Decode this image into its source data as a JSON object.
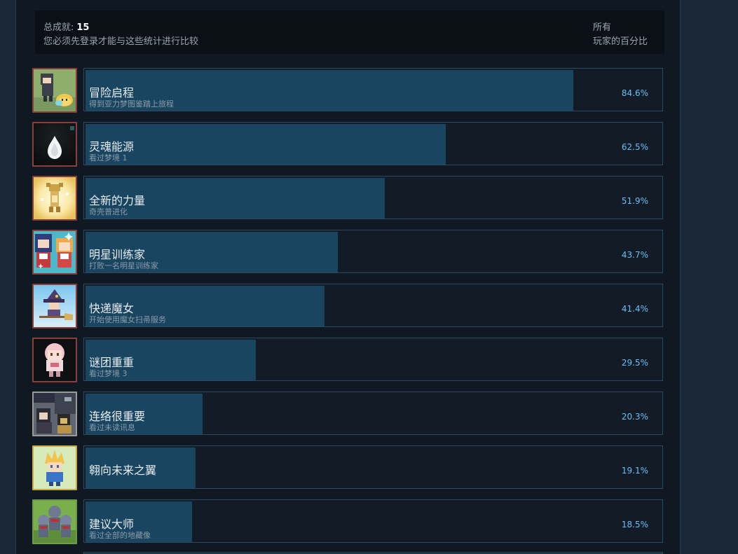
{
  "header": {
    "total_label": "总成就:",
    "total_value": "15",
    "login_note": "您必须先登录才能与这些统计进行比较",
    "all_label": "所有",
    "percent_label": "玩家的百分比"
  },
  "achievements": [
    {
      "name": "冒险启程",
      "desc": "得到亚力梦图鉴踏上旅程",
      "percent": "84.6%",
      "value": 84.6,
      "icon": "hooded-figure-with-slime-icon"
    },
    {
      "name": "灵魂能源",
      "desc": "看过梦境 1",
      "percent": "62.5%",
      "value": 62.5,
      "icon": "soul-flame-icon"
    },
    {
      "name": "全新的力量",
      "desc": "奇壳普进化",
      "percent": "51.9%",
      "value": 51.9,
      "icon": "glowing-creature-icon"
    },
    {
      "name": "明星训练家",
      "desc": "打败一名明星训练家",
      "percent": "43.7%",
      "value": 43.7,
      "icon": "two-trainers-icon"
    },
    {
      "name": "快递魔女",
      "desc": "开始使用魔女扫帚服务",
      "percent": "41.4%",
      "value": 41.4,
      "icon": "witch-on-broom-icon"
    },
    {
      "name": "谜团重重",
      "desc": "看过梦境 3",
      "percent": "29.5%",
      "value": 29.5,
      "icon": "pink-haired-girl-icon"
    },
    {
      "name": "连络很重要",
      "desc": "看过未读讯息",
      "percent": "20.3%",
      "value": 20.3,
      "icon": "message-scene-icon"
    },
    {
      "name": "翱向未来之翼",
      "desc": "",
      "percent": "19.1%",
      "value": 19.1,
      "icon": "spiky-hair-hero-icon"
    },
    {
      "name": "建议大师",
      "desc": "看过全部的地藏像",
      "percent": "18.5%",
      "value": 18.5,
      "icon": "jizo-statues-icon"
    }
  ]
}
